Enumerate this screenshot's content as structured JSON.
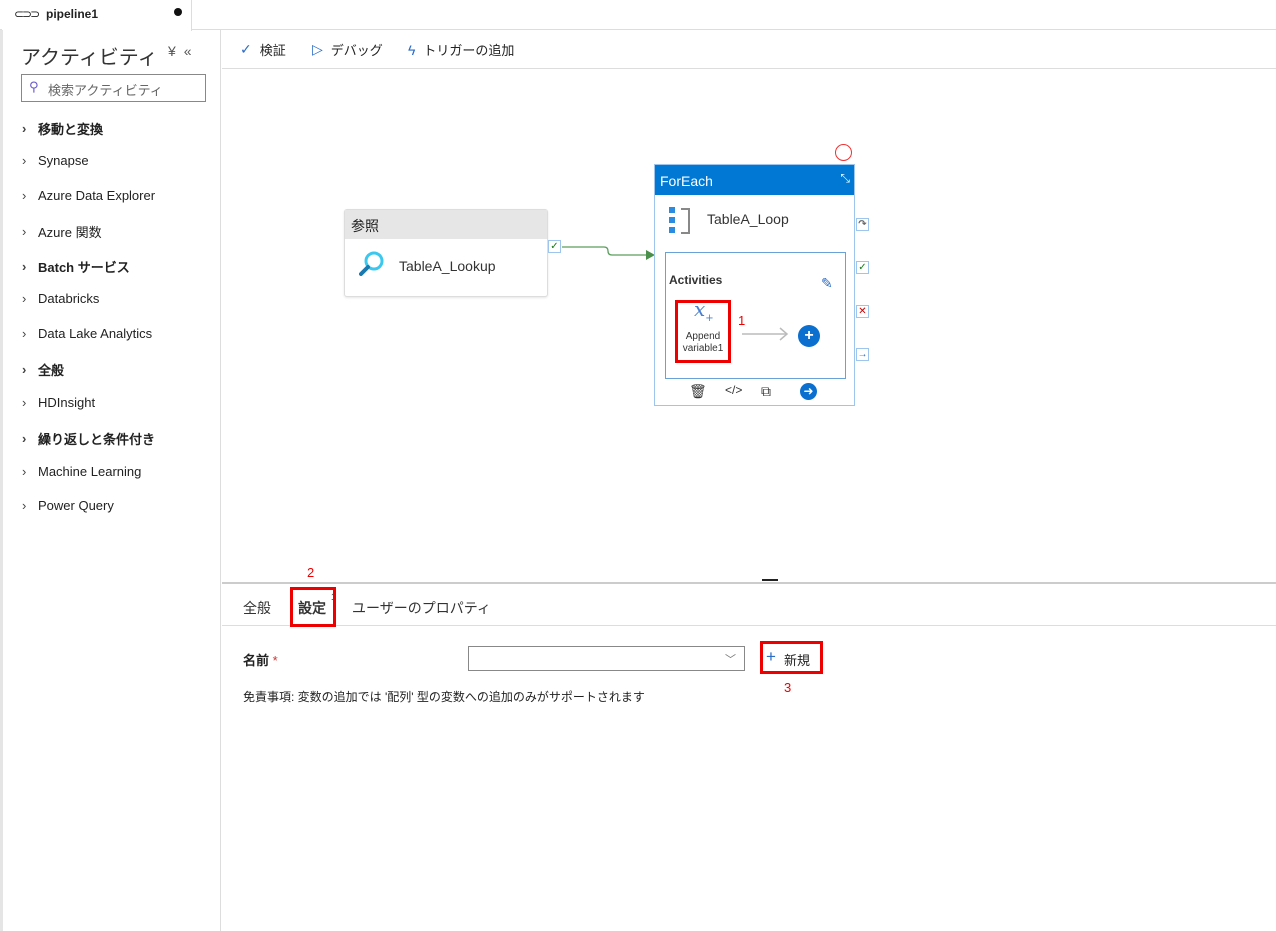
{
  "tab": {
    "title": "pipeline1",
    "icon": "pipeline-icon",
    "unsaved": true
  },
  "sidebar": {
    "title": "アクティビティ",
    "search_placeholder": "検索アクティビティ",
    "items": [
      {
        "label": "移動と変換"
      },
      {
        "label": "Synapse"
      },
      {
        "label": "Azure Data Explorer"
      },
      {
        "label": "Azure 関数"
      },
      {
        "label": "Batch サービス"
      },
      {
        "label": "Databricks"
      },
      {
        "label": "Data Lake Analytics"
      },
      {
        "label": "全般"
      },
      {
        "label": "HDInsight"
      },
      {
        "label": "繰り返しと条件付き"
      },
      {
        "label": "Machine Learning"
      },
      {
        "label": "Power Query"
      }
    ]
  },
  "toolbar": {
    "validate": "検証",
    "debug": "デバッグ",
    "add_trigger": "トリガーの追加"
  },
  "canvas": {
    "lookup": {
      "type": "参照",
      "name": "TableA_Lookup"
    },
    "foreach": {
      "type": "ForEach",
      "name": "TableA_Loop",
      "activities_label": "Activities",
      "inner_activity": {
        "line1": "Append",
        "line2": "variable1"
      }
    }
  },
  "annotations": {
    "n1": "1",
    "n2": "2",
    "n3": "3"
  },
  "panel": {
    "tabs": [
      {
        "label": "全般"
      },
      {
        "label": "設定",
        "badge": "1"
      },
      {
        "label": "ユーザーのプロパティ"
      }
    ],
    "name_label": "名前",
    "required_mark": "*",
    "new_button": "新規",
    "disclaimer": "免責事項: 変数の追加では '配列' 型の変数への追加のみがサポートされます"
  },
  "colors": {
    "accent": "#0078d4",
    "annotation": "#e00000",
    "success": "#107c10"
  }
}
